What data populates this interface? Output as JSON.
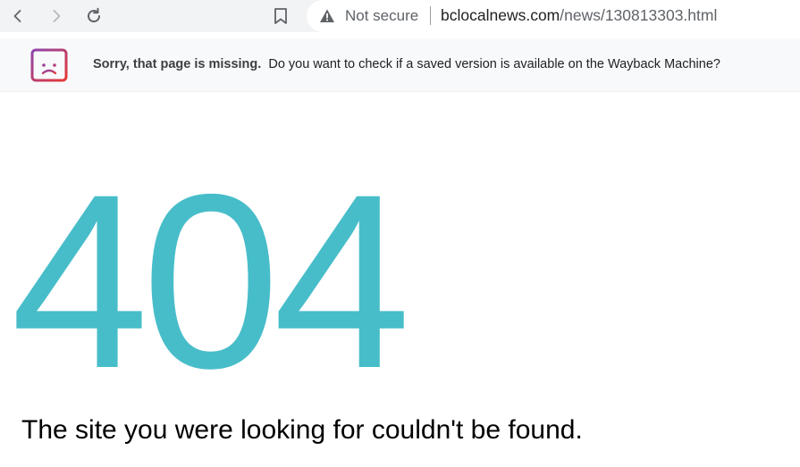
{
  "browser": {
    "back_icon": "chevron-left-icon",
    "forward_icon": "chevron-right-icon",
    "reload_icon": "reload-icon",
    "bookmark_icon": "bookmark-icon",
    "security_icon": "warning-triangle-icon",
    "security_label": "Not secure",
    "url_domain": "bclocalnews.com",
    "url_path": "/news/130813303.html"
  },
  "infobar": {
    "icon": "sad-browser-icon",
    "title": "Sorry, that page is missing.",
    "message": "Do you want to check if a saved version is available on the Wayback Machine?",
    "icon_colors": [
      "#8e44ad",
      "#e53935"
    ]
  },
  "page": {
    "error_code": "404",
    "error_code_color": "#47bdc9",
    "message": "The site you were looking for couldn't be found."
  }
}
